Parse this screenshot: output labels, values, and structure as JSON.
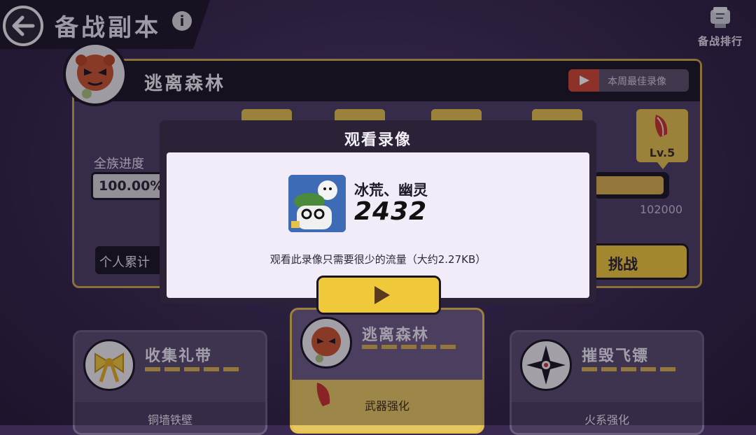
{
  "header": {
    "title": "备战副本",
    "info_icon": "i",
    "rank_label": "备战排行"
  },
  "main": {
    "stage_name": "逃离森林",
    "best_replay_label": "本周最佳录像",
    "level_badge": "Lv.5",
    "progress_label": "全族进度",
    "progress_value": "100.00%",
    "score_right": "102000",
    "personal_label": "个人累计",
    "challenge_label": "挑战"
  },
  "cards": [
    {
      "name": "收集礼带",
      "sub": "铜墙铁壁"
    },
    {
      "name": "逃离森林",
      "sub": "武器强化"
    },
    {
      "name": "摧毁飞镖",
      "sub": "火系强化"
    }
  ],
  "modal": {
    "title": "观看录像",
    "player_name": "冰荒、幽灵",
    "player_score": "2432",
    "traffic_note": "观看此录像只需要很少的流量（大约2.27KB）"
  },
  "colors": {
    "accent_gold": "#f0c93a",
    "panel_purple": "#4b3d62",
    "dark": "#1a1520",
    "modal_bg": "#f1ecf8"
  },
  "icons": [
    "back-arrow-icon",
    "info-icon",
    "rank-trophy-icon",
    "play-icon",
    "feather-icon",
    "ribbon-icon",
    "shuriken-icon"
  ]
}
